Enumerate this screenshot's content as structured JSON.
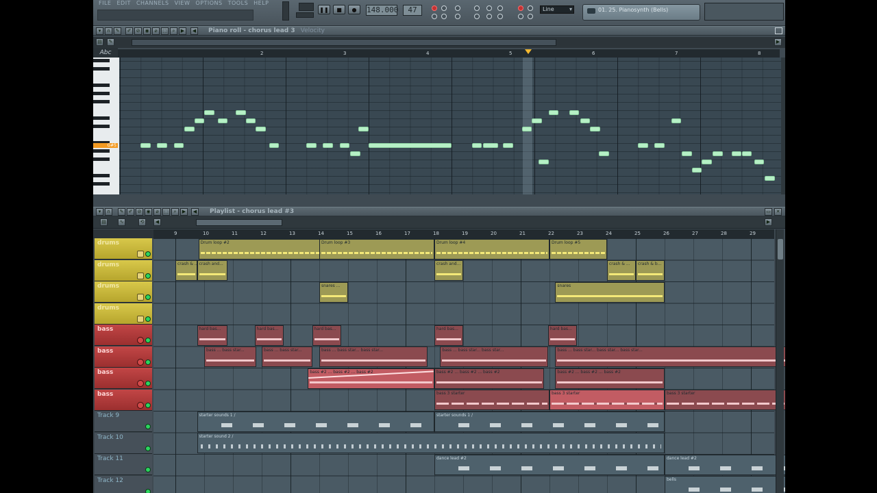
{
  "menu": [
    "FILE",
    "EDIT",
    "CHANNELS",
    "VIEW",
    "OPTIONS",
    "TOOLS",
    "HELP"
  ],
  "transport": {
    "tempo": "148.000",
    "pattern": "47",
    "snap": "Line",
    "channel_display": "01. 25. Pianosynth (Bells)"
  },
  "piano_roll": {
    "title": "Piano roll - chorus lead 3",
    "target": "Velocity",
    "ruler": [
      "2",
      "3",
      "4",
      "5",
      "6",
      "7",
      "8"
    ],
    "highlight_key": "G#5"
  },
  "playlist": {
    "title": "Playlist - chorus lead #3",
    "ruler": [
      "9",
      "10",
      "11",
      "12",
      "13",
      "14",
      "15",
      "16",
      "17",
      "18",
      "19",
      "20",
      "21",
      "22",
      "23",
      "24",
      "25",
      "26",
      "27",
      "28",
      "29"
    ],
    "tracks": [
      {
        "name": "drums"
      },
      {
        "name": "drums"
      },
      {
        "name": "drums"
      },
      {
        "name": "drums"
      },
      {
        "name": "bass"
      },
      {
        "name": "bass"
      },
      {
        "name": "bass"
      },
      {
        "name": "bass"
      },
      {
        "name": "Track 9"
      },
      {
        "name": "Track 10"
      },
      {
        "name": "Track 11"
      },
      {
        "name": "Track 12"
      }
    ],
    "clips": [
      {
        "row": 0,
        "start": 0.8,
        "end": 8.0,
        "label": "Drum loop #2",
        "kind": "drum"
      },
      {
        "row": 0,
        "start": 5.0,
        "end": 9.0,
        "label": "Drum loop #3",
        "kind": "drum"
      },
      {
        "row": 0,
        "start": 9.0,
        "end": 13.0,
        "label": "Drum loop #4",
        "kind": "drum"
      },
      {
        "row": 0,
        "start": 13.0,
        "end": 15.0,
        "label": "Drum loop #5",
        "kind": "drum"
      },
      {
        "row": 1,
        "start": 0.0,
        "end": 0.75,
        "label": "crash & ...",
        "kind": "drum-solid"
      },
      {
        "row": 1,
        "start": 0.75,
        "end": 1.8,
        "label": "crash and...",
        "kind": "drum-solid"
      },
      {
        "row": 1,
        "start": 9.0,
        "end": 10.0,
        "label": "crash and...",
        "kind": "drum-solid"
      },
      {
        "row": 1,
        "start": 15.0,
        "end": 16.0,
        "label": "crash & ...",
        "kind": "drum-solid"
      },
      {
        "row": 1,
        "start": 16.0,
        "end": 17.0,
        "label": "crash & b...",
        "kind": "drum-solid"
      },
      {
        "row": 2,
        "start": 5.0,
        "end": 6.0,
        "label": "snares ...",
        "kind": "drum-solid"
      },
      {
        "row": 2,
        "start": 13.2,
        "end": 17.0,
        "label": "snares",
        "kind": "drum-solid"
      },
      {
        "row": 4,
        "start": 0.75,
        "end": 1.8,
        "label": "hard bas...",
        "kind": "bass"
      },
      {
        "row": 4,
        "start": 2.75,
        "end": 3.75,
        "label": "hard bas...",
        "kind": "bass"
      },
      {
        "row": 4,
        "start": 4.75,
        "end": 5.75,
        "label": "hard bas...",
        "kind": "bass"
      },
      {
        "row": 4,
        "start": 9.0,
        "end": 10.0,
        "label": "hard bas...",
        "kind": "bass"
      },
      {
        "row": 4,
        "start": 12.95,
        "end": 13.95,
        "label": "hard bas...",
        "kind": "bass"
      },
      {
        "row": 5,
        "start": 1.0,
        "end": 2.8,
        "label": "bass ... bass star...",
        "kind": "bass"
      },
      {
        "row": 5,
        "start": 3.0,
        "end": 4.75,
        "label": "bass ... bass star...",
        "kind": "bass"
      },
      {
        "row": 5,
        "start": 5.0,
        "end": 8.75,
        "label": "bass ... bass star... bass star...",
        "kind": "bass"
      },
      {
        "row": 5,
        "start": 9.2,
        "end": 12.95,
        "label": "bass ... bass star... bass star...",
        "kind": "bass"
      },
      {
        "row": 5,
        "start": 13.2,
        "end": 21.5,
        "label": "bass ... bass star... bass star... bass star...",
        "kind": "bass"
      },
      {
        "row": 6,
        "start": 4.6,
        "end": 9.0,
        "label": "bass #2 ... bass #2 ... bass #2",
        "kind": "bass-slide"
      },
      {
        "row": 6,
        "start": 9.0,
        "end": 12.8,
        "label": "bass #2 ... bass #2 ... bass #2",
        "kind": "bass"
      },
      {
        "row": 6,
        "start": 13.2,
        "end": 17.0,
        "label": "bass #2 ... bass #2 ... bass #2",
        "kind": "bass"
      },
      {
        "row": 7,
        "start": 9.0,
        "end": 13.0,
        "label": "bass 3 starter",
        "kind": "bass-dash"
      },
      {
        "row": 7,
        "start": 13.0,
        "end": 17.0,
        "label": "bass 3 starter",
        "kind": "bass-dash-hi"
      },
      {
        "row": 7,
        "start": 17.0,
        "end": 21.5,
        "label": "bass 3 starter",
        "kind": "bass-dash"
      },
      {
        "row": 8,
        "start": 0.75,
        "end": 9.0,
        "label": "starter sounds 1 /",
        "kind": "pattern-sparse"
      },
      {
        "row": 8,
        "start": 9.0,
        "end": 17.0,
        "label": "starter sounds 1 /",
        "kind": "pattern-sparse"
      },
      {
        "row": 9,
        "start": 0.75,
        "end": 17.0,
        "label": "starter sound 2 /",
        "kind": "pattern"
      },
      {
        "row": 10,
        "start": 9.0,
        "end": 17.0,
        "label": "dance lead #2",
        "kind": "pattern-sparse"
      },
      {
        "row": 10,
        "start": 17.0,
        "end": 21.5,
        "label": "dance lead #2",
        "kind": "pattern-sparse"
      },
      {
        "row": 11,
        "start": 17.0,
        "end": 21.5,
        "label": "bells",
        "kind": "pattern-sparse"
      }
    ]
  },
  "notes": [
    {
      "bar": 1.25,
      "len": 0.12,
      "row": 7
    },
    {
      "bar": 1.45,
      "len": 0.12,
      "row": 7
    },
    {
      "bar": 1.65,
      "len": 0.12,
      "row": 7
    },
    {
      "bar": 1.78,
      "len": 0.12,
      "row": 5
    },
    {
      "bar": 1.9,
      "len": 0.12,
      "row": 4
    },
    {
      "bar": 2.02,
      "len": 0.12,
      "row": 3
    },
    {
      "bar": 2.18,
      "len": 0.12,
      "row": 4
    },
    {
      "bar": 2.4,
      "len": 0.12,
      "row": 3
    },
    {
      "bar": 2.52,
      "len": 0.12,
      "row": 4
    },
    {
      "bar": 2.64,
      "len": 0.12,
      "row": 5
    },
    {
      "bar": 2.8,
      "len": 0.12,
      "row": 7
    },
    {
      "bar": 3.25,
      "len": 0.12,
      "row": 7
    },
    {
      "bar": 3.45,
      "len": 0.12,
      "row": 7
    },
    {
      "bar": 3.65,
      "len": 0.12,
      "row": 7
    },
    {
      "bar": 3.78,
      "len": 0.12,
      "row": 8
    },
    {
      "bar": 3.88,
      "len": 0.12,
      "row": 5
    },
    {
      "bar": 4.0,
      "len": 1.0,
      "row": 7
    },
    {
      "bar": 5.25,
      "len": 0.06,
      "row": 7
    },
    {
      "bar": 5.38,
      "len": 0.18,
      "row": 7
    },
    {
      "bar": 5.62,
      "len": 0.12,
      "row": 7
    },
    {
      "bar": 5.85,
      "len": 0.12,
      "row": 5
    },
    {
      "bar": 5.97,
      "len": 0.12,
      "row": 4
    },
    {
      "bar": 6.05,
      "len": 0.12,
      "row": 9
    },
    {
      "bar": 6.17,
      "len": 0.12,
      "row": 3
    },
    {
      "bar": 6.42,
      "len": 0.12,
      "row": 3
    },
    {
      "bar": 6.55,
      "len": 0.12,
      "row": 4
    },
    {
      "bar": 6.67,
      "len": 0.12,
      "row": 5
    },
    {
      "bar": 6.78,
      "len": 0.12,
      "row": 8
    },
    {
      "bar": 7.25,
      "len": 0.12,
      "row": 7
    },
    {
      "bar": 7.45,
      "len": 0.12,
      "row": 7
    },
    {
      "bar": 7.65,
      "len": 0.12,
      "row": 4
    },
    {
      "bar": 7.78,
      "len": 0.12,
      "row": 8
    },
    {
      "bar": 7.9,
      "len": 0.12,
      "row": 10
    },
    {
      "bar": 8.02,
      "len": 0.12,
      "row": 9
    },
    {
      "bar": 8.15,
      "len": 0.12,
      "row": 8
    },
    {
      "bar": 8.38,
      "len": 0.12,
      "row": 8
    },
    {
      "bar": 8.5,
      "len": 0.12,
      "row": 8
    },
    {
      "bar": 8.65,
      "len": 0.12,
      "row": 9
    },
    {
      "bar": 8.78,
      "len": 0.12,
      "row": 11
    }
  ]
}
